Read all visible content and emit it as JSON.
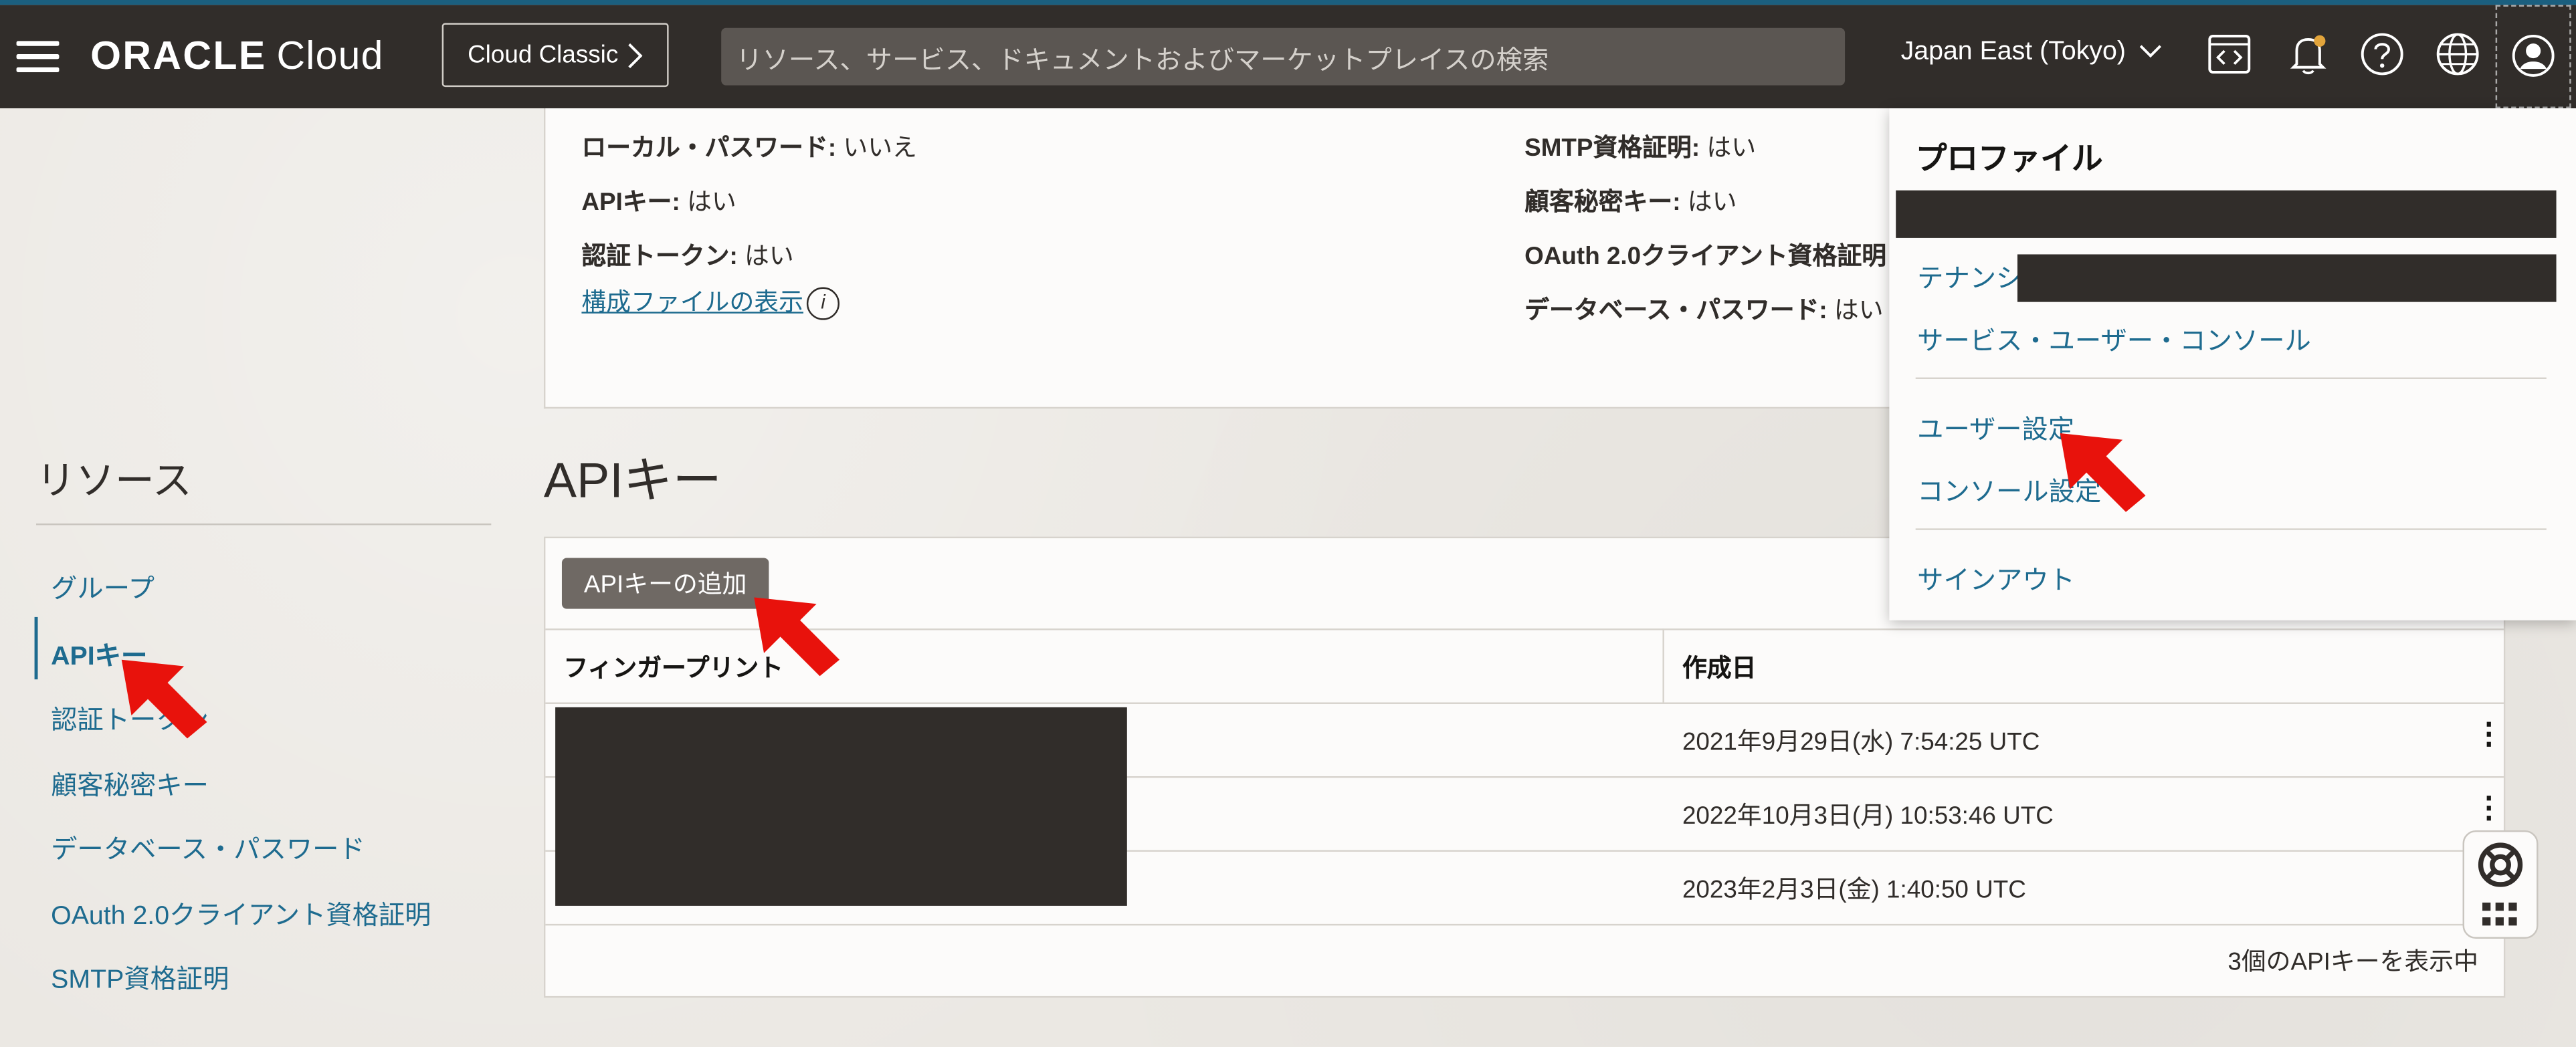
{
  "header": {
    "brand": "ORACLE",
    "product": "Cloud",
    "classic_button": "Cloud Classic",
    "search_placeholder": "リソース、サービス、ドキュメントおよびマーケットプレイスの検索",
    "region": "Japan East (Tokyo)",
    "icons": [
      "code-editor-icon",
      "bell-icon",
      "help-icon",
      "globe-icon",
      "profile-icon"
    ]
  },
  "info": {
    "local_password_label": "ローカル・パスワード:",
    "local_password_value": "いいえ",
    "api_keys_label": "APIキー:",
    "api_keys_value": "はい",
    "auth_tokens_label": "認証トークン:",
    "auth_tokens_value": "はい",
    "config_link": "構成ファイルの表示",
    "smtp_label": "SMTP資格証明:",
    "smtp_value": "はい",
    "customer_secret_label": "顧客秘密キー:",
    "customer_secret_value": "はい",
    "oauth_label": "OAuth 2.0クライアント資格証明",
    "db_password_label": "データベース・パスワード:",
    "db_password_value": "はい"
  },
  "resources": {
    "title": "リソース",
    "items": [
      {
        "label": "グループ",
        "active": false
      },
      {
        "label": "APIキー",
        "active": true
      },
      {
        "label": "認証トークン",
        "active": false
      },
      {
        "label": "顧客秘密キー",
        "active": false
      },
      {
        "label": "データベース・パスワード",
        "active": false
      },
      {
        "label": "OAuth 2.0クライアント資格証明",
        "active": false
      },
      {
        "label": "SMTP資格証明",
        "active": false
      }
    ]
  },
  "api_keys": {
    "title": "APIキー",
    "add_button": "APIキーの追加",
    "columns": [
      "フィンガープリント",
      "作成日"
    ],
    "rows": [
      {
        "created": "2021年9月29日(水) 7:54:25 UTC"
      },
      {
        "created": "2022年10月3日(月) 10:53:46 UTC"
      },
      {
        "created": "2023年2月3日(金) 1:40:50 UTC"
      }
    ],
    "footer": "3個のAPIキーを表示中"
  },
  "profile_menu": {
    "title": "プロファイル",
    "tenancy_label": "テナンシ",
    "service_console": "サービス・ユーザー・コンソール",
    "user_settings": "ユーザー設定",
    "console_settings": "コンソール設定",
    "sign_out": "サインアウト"
  },
  "colors": {
    "header_bg": "#312d2a",
    "link": "#1e6b8f",
    "annotation_arrow": "#e8120c",
    "redaction": "#312d2a"
  }
}
